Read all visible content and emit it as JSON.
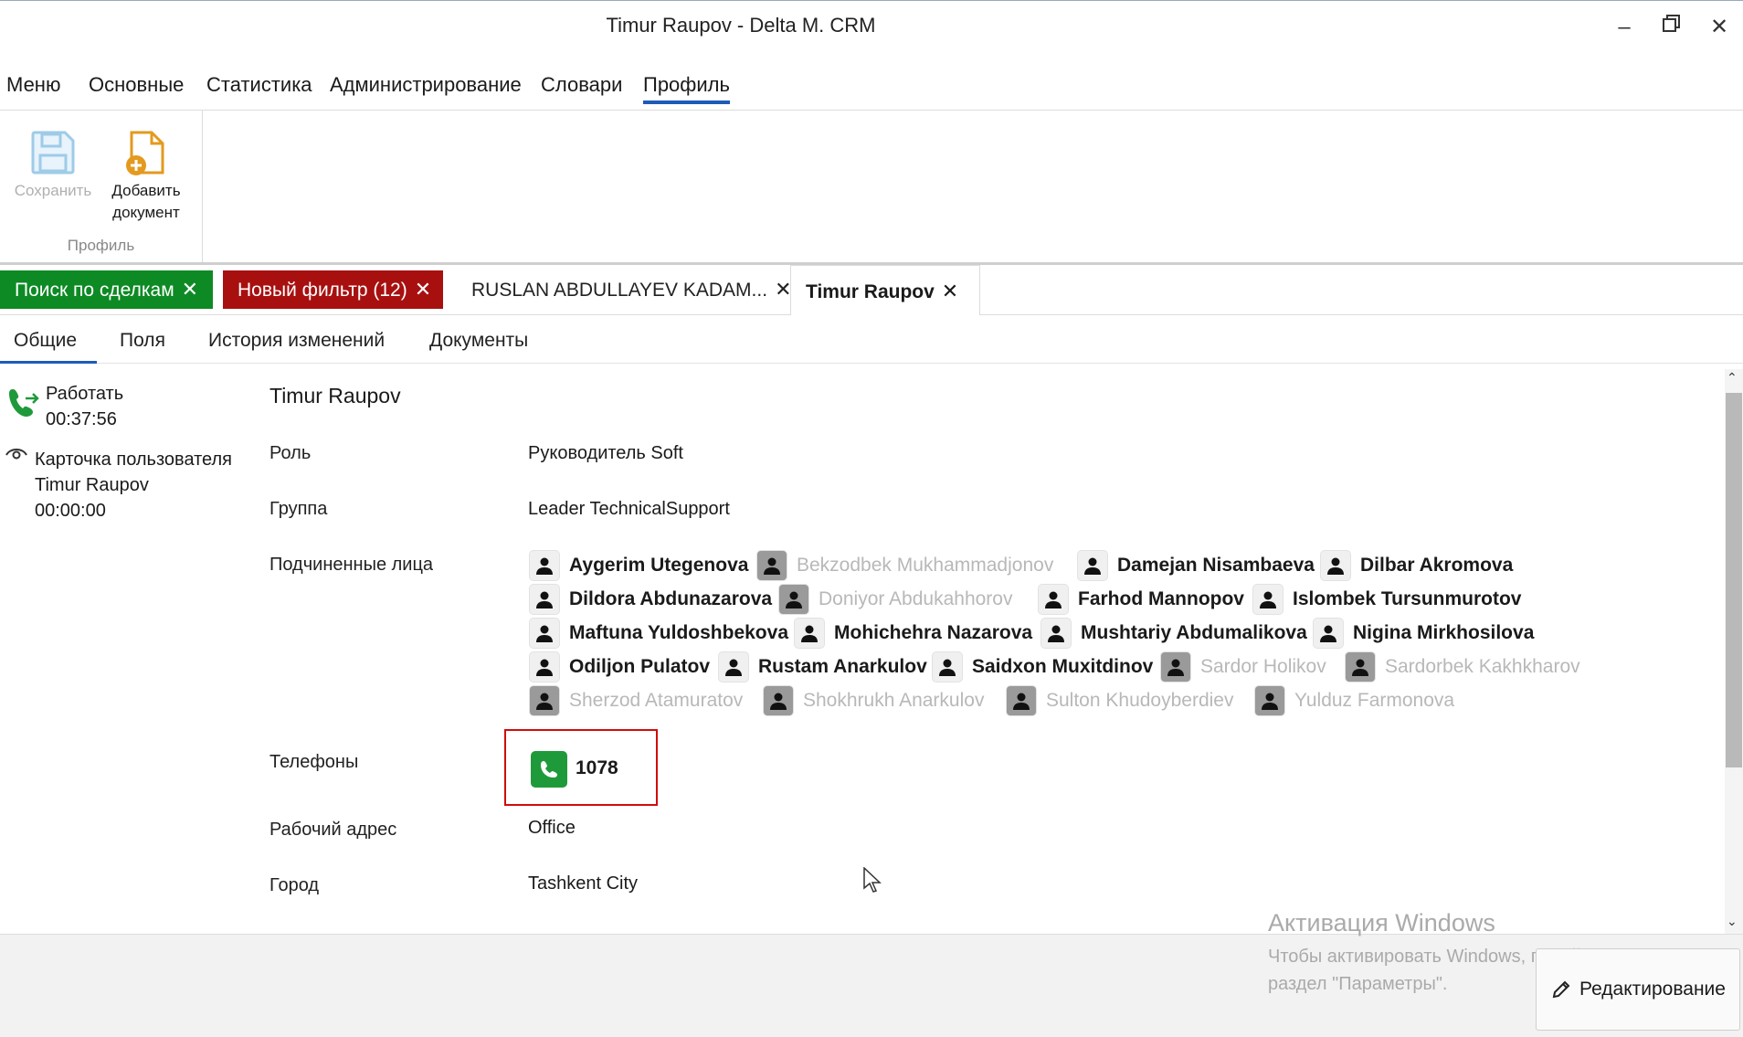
{
  "window": {
    "title": "Timur Raupov - Delta M. CRM"
  },
  "menu": [
    "Меню",
    "Основные",
    "Статистика",
    "Администрирование",
    "Словари",
    "Профиль"
  ],
  "ribbon": {
    "save_label": "Сохранить",
    "add_doc_label_1": "Добавить",
    "add_doc_label_2": "документ",
    "group_label": "Профиль"
  },
  "doc_tabs": [
    {
      "label": "Поиск по сделкам",
      "style": "green"
    },
    {
      "label": "Новый фильтр (12)",
      "style": "red"
    },
    {
      "label": "RUSLAN ABDULLAYEV KADAM...",
      "style": "plain"
    },
    {
      "label": "Timur Raupov",
      "style": "active"
    }
  ],
  "sub_tabs": [
    "Общие",
    "Поля",
    "История изменений",
    "Документы"
  ],
  "left_panel": {
    "status_label": "Работать",
    "status_time": "00:37:56",
    "card_label": "Карточка пользователя",
    "card_name": "Timur Raupov",
    "card_time": "00:00:00"
  },
  "profile": {
    "name": "Timur Raupov",
    "role_label": "Роль",
    "role_value": "Руководитель Soft",
    "group_label": "Группа",
    "group_value": "Leader TechnicalSupport",
    "subordinates_label": "Подчиненные лица",
    "phones_label": "Телефоны",
    "phone_value": "1078",
    "address_label": "Рабочий адрес",
    "address_value": "Office",
    "city_label": "Город",
    "city_value": "Tashkent City"
  },
  "subordinates": [
    {
      "name": "Aygerim Utegenova",
      "active": true
    },
    {
      "name": "Bekzodbek Mukhammadjonov",
      "active": false
    },
    {
      "name": "Damejan Nisambaeva",
      "active": true
    },
    {
      "name": "Dilbar Akromova",
      "active": true
    },
    {
      "name": "Dildora Abdunazarova",
      "active": true
    },
    {
      "name": "Doniyor Abdukahhorov",
      "active": false
    },
    {
      "name": "Farhod Mannopov",
      "active": true
    },
    {
      "name": "Islombek Tursunmurotov",
      "active": true
    },
    {
      "name": "Maftuna Yuldoshbekova",
      "active": true
    },
    {
      "name": "Mohichehra Nazarova",
      "active": true
    },
    {
      "name": "Mushtariy Abdumalikova",
      "active": true
    },
    {
      "name": "Nigina Mirkhosilova",
      "active": true
    },
    {
      "name": "Odiljon Pulatov",
      "active": true
    },
    {
      "name": "Rustam Anarkulov",
      "active": true
    },
    {
      "name": "Saidxon Muxitdinov",
      "active": true
    },
    {
      "name": "Sardor Holikov",
      "active": false
    },
    {
      "name": "Sardorbek Kakhkharov",
      "active": false
    },
    {
      "name": "Sherzod Atamuratov",
      "active": false
    },
    {
      "name": "Shokhrukh Anarkulov",
      "active": false
    },
    {
      "name": "Sulton Khudoyberdiev",
      "active": false
    },
    {
      "name": "Yulduz Farmonova",
      "active": false
    }
  ],
  "activation": {
    "title": "Активация Windows",
    "text": "Чтобы активировать Windows, перейдите в раздел \"Параметры\"."
  },
  "edit_button": "Редактирование",
  "colors": {
    "accent": "#1e5bb8",
    "green_tab": "#0d8a24",
    "red_tab": "#a81010",
    "phone_green": "#1f9a3b",
    "highlight_red": "#d10c0c"
  }
}
